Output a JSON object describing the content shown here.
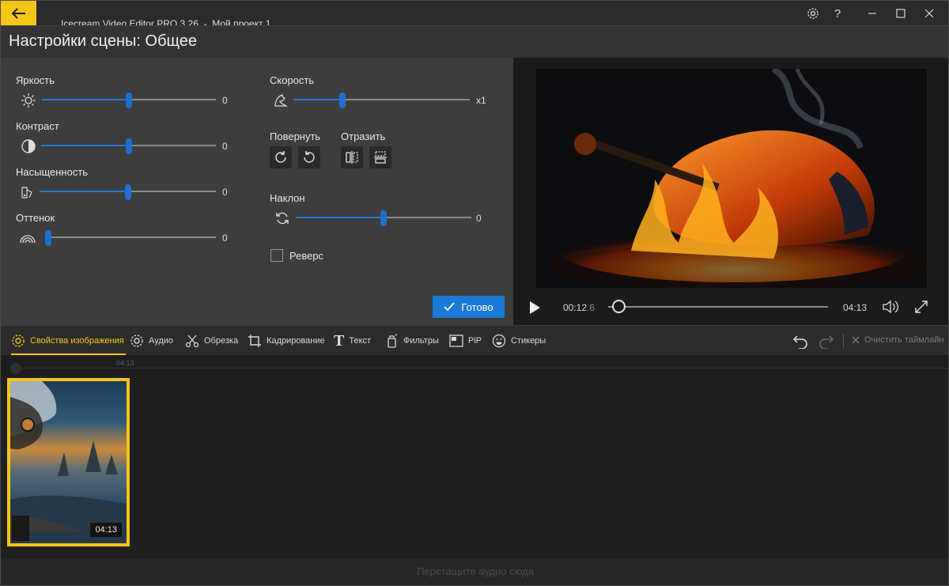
{
  "titlebar": {
    "app_name": "Icecream Video Editor PRO 3.26",
    "separator": "-",
    "project_name": "Мой проект 1",
    "help_label": "?"
  },
  "page": {
    "title": "Настройки сцены: Общее"
  },
  "settings": {
    "brightness": {
      "label": "Яркость",
      "value": "0",
      "level": 0.5
    },
    "contrast": {
      "label": "Контраст",
      "value": "0",
      "level": 0.5
    },
    "saturation": {
      "label": "Насыщенность",
      "value": "0",
      "level": 0.5
    },
    "hue": {
      "label": "Оттенок",
      "value": "0",
      "level": 0.0
    },
    "speed": {
      "label": "Скорость",
      "value": "x1",
      "level": 0.28
    },
    "rotate_label": "Повернуть",
    "flip_label": "Отразить",
    "tilt": {
      "label": "Наклон",
      "value": "0",
      "level": 0.5
    },
    "reverse_label": "Реверс",
    "done_label": "Готово"
  },
  "player": {
    "current_time_main": "00:12",
    "current_time_fraction": ".6",
    "duration": "04:13",
    "progress": 0.05
  },
  "toolbar": {
    "tools": [
      {
        "label": "Свойства изображения",
        "icon": "gear-icon",
        "active": true
      },
      {
        "label": "Аудио",
        "icon": "gear-icon"
      },
      {
        "label": "Обрезка",
        "icon": "scissors-icon"
      },
      {
        "label": "Кадрирование",
        "icon": "crop-icon"
      },
      {
        "label": "Текст",
        "icon": "text-icon"
      },
      {
        "label": "Фильтры",
        "icon": "filter-icon"
      },
      {
        "label": "PiP",
        "icon": "pip-icon"
      },
      {
        "label": "Стикеры",
        "icon": "smiley-icon"
      }
    ],
    "clear_timeline_label": "Очистить таймлайн"
  },
  "timeline": {
    "ruler_label": "04:13",
    "clip_duration": "04:13",
    "audio_drop_text": "Перетащите аудио сюда"
  },
  "colors": {
    "accent": "#f5c518",
    "primary_button": "#1b7ad6",
    "slider_thumb": "#1f6fd0"
  }
}
